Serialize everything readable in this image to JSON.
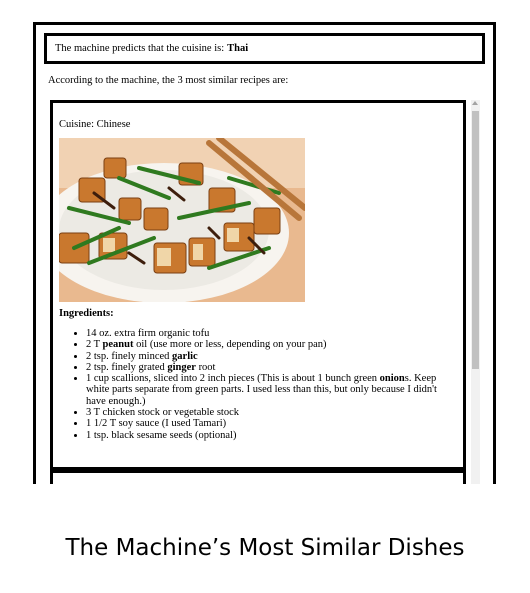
{
  "prediction": {
    "prefix": "The machine predicts that the cuisine is:",
    "cuisine": "Thai"
  },
  "similar_text": "According to the machine, the 3 most similar recipes are:",
  "recipe": {
    "cuisine_label": "Cuisine: Chinese",
    "image_icon": "dish-photo-tofu-stir-fry",
    "ingredients_heading": "Ingredients:",
    "ingredients": [
      {
        "pre": "14 oz. extra firm organic tofu",
        "bold": "",
        "post": ""
      },
      {
        "pre": "2 T ",
        "bold": "peanut",
        "post": " oil (use more or less, depending on your pan)"
      },
      {
        "pre": "2 tsp. finely minced ",
        "bold": "garlic",
        "post": ""
      },
      {
        "pre": "2 tsp. finely grated ",
        "bold": "ginger",
        "post": " root"
      },
      {
        "pre": "1 cup scallions, sliced into 2 inch pieces (This is about 1 bunch green ",
        "bold": "onion",
        "post": "s. Keep white parts separate from green parts. I used less than this, but only because I didn't have enough.)"
      },
      {
        "pre": "3 T chicken stock or vegetable stock",
        "bold": "",
        "post": ""
      },
      {
        "pre": "1 1/2 T soy sauce (I used Tamari)",
        "bold": "",
        "post": ""
      },
      {
        "pre": "1 tsp. black sesame seeds (optional)",
        "bold": "",
        "post": ""
      }
    ]
  },
  "caption": "The Machine’s Most Similar Dishes"
}
